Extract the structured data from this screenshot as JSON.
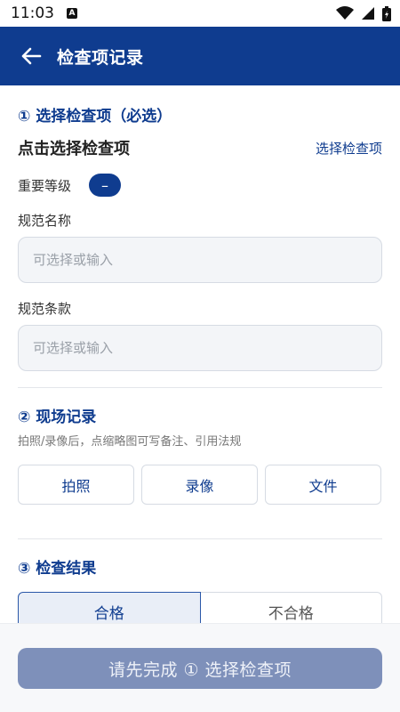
{
  "status_bar": {
    "time": "11:03",
    "notification_icon": "A"
  },
  "header": {
    "title": "检查项记录"
  },
  "section1": {
    "title": "① 选择检查项（必选）",
    "pick_title": "点击选择检查项",
    "pick_link": "选择检查项",
    "level_label": "重要等级",
    "level_value": "–",
    "spec_name_label": "规范名称",
    "spec_name_placeholder": "可选择或输入",
    "spec_clause_label": "规范条款",
    "spec_clause_placeholder": "可选择或输入"
  },
  "section2": {
    "title": "② 现场记录",
    "hint": "拍照/录像后，点缩略图可写备注、引用法规",
    "buttons": [
      "拍照",
      "录像",
      "文件"
    ]
  },
  "section3": {
    "title": "③ 检查结果",
    "options": [
      "合格",
      "不合格"
    ]
  },
  "footer": {
    "submit_label": "请先完成 ① 选择检查项"
  },
  "colors": {
    "primary": "#0f3c8f",
    "disabled_button": "#7e90ba"
  }
}
